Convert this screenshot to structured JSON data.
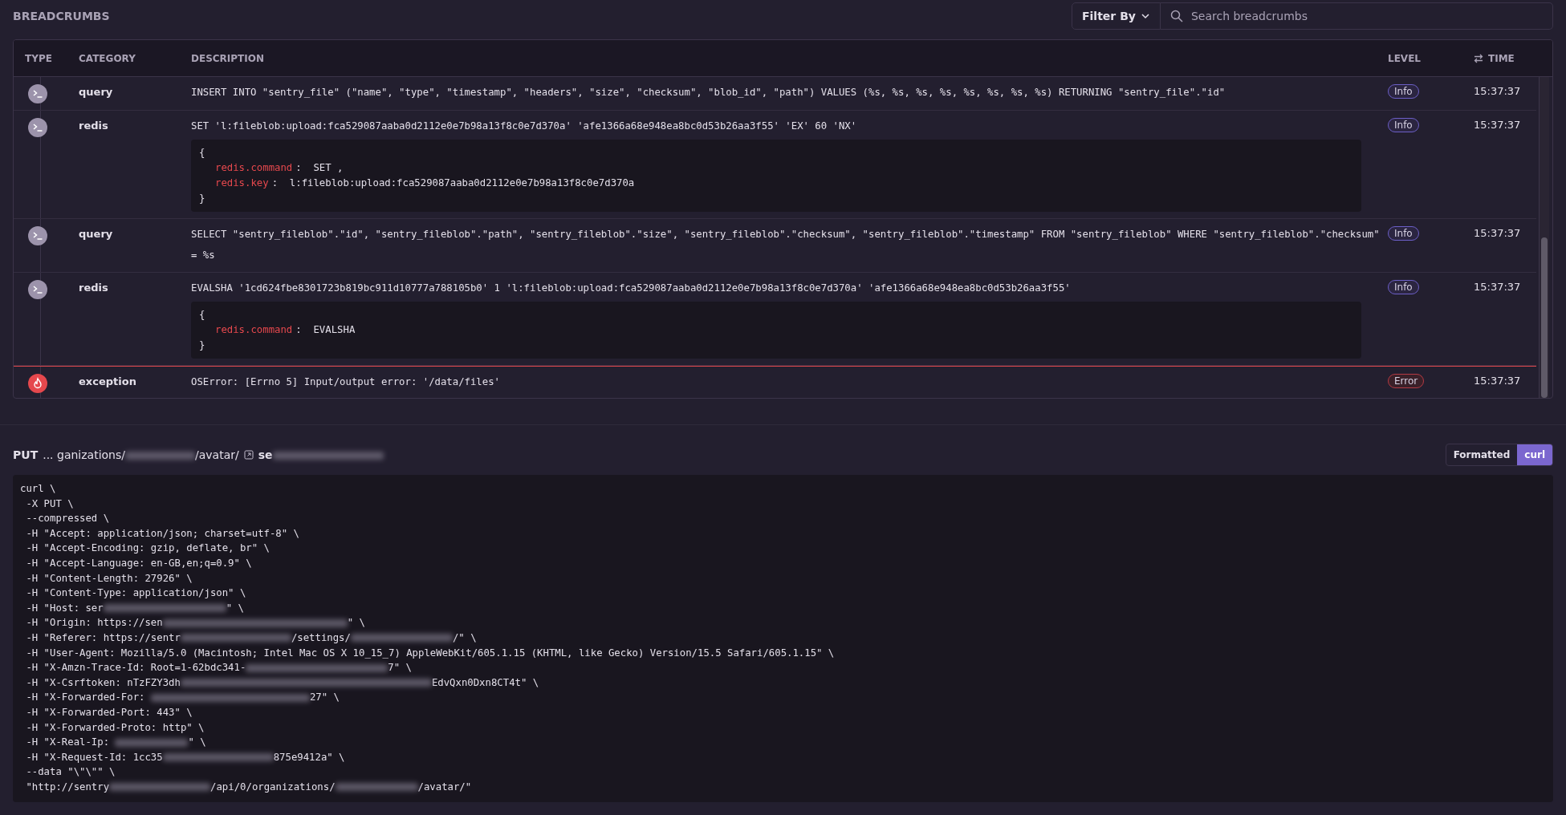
{
  "breadcrumbs": {
    "title": "BREADCRUMBS",
    "filter": {
      "label": "Filter By"
    },
    "search": {
      "placeholder": "Search breadcrumbs"
    },
    "columns": [
      "TYPE",
      "CATEGORY",
      "DESCRIPTION",
      "LEVEL",
      "TIME"
    ],
    "rows": [
      {
        "kind": "default",
        "category": "query",
        "description": "INSERT INTO \"sentry_file\" (\"name\", \"type\", \"timestamp\", \"headers\", \"size\", \"checksum\", \"blob_id\", \"path\") VALUES (%s, %s, %s, %s, %s, %s, %s, %s) RETURNING \"sentry_file\".\"id\"",
        "level": "Info",
        "time": "15:37:37"
      },
      {
        "kind": "default",
        "category": "redis",
        "description": "SET 'l:fileblob:upload:fca529087aaba0d2112e0e7b98a13f8c0e7d370a' 'afe1366a68e948ea8bc0d53b26aa3f55' 'EX' 60 'NX'",
        "data": {
          "open": "{",
          "entries": [
            {
              "key": "redis.command",
              "value": ":  SET ,"
            },
            {
              "key": "redis.key",
              "value": ":  l:fileblob:upload:fca529087aaba0d2112e0e7b98a13f8c0e7d370a"
            }
          ],
          "close": "}"
        },
        "level": "Info",
        "time": "15:37:37"
      },
      {
        "kind": "default",
        "category": "query",
        "description": "SELECT \"sentry_fileblob\".\"id\", \"sentry_fileblob\".\"path\", \"sentry_fileblob\".\"size\", \"sentry_fileblob\".\"checksum\", \"sentry_fileblob\".\"timestamp\" FROM \"sentry_fileblob\" WHERE \"sentry_fileblob\".\"checksum\" = %s",
        "level": "Info",
        "time": "15:37:37"
      },
      {
        "kind": "default",
        "category": "redis",
        "description": "EVALSHA '1cd624fbe8301723b819bc911d10777a788105b0' 1 'l:fileblob:upload:fca529087aaba0d2112e0e7b98a13f8c0e7d370a' 'afe1366a68e948ea8bc0d53b26aa3f55'",
        "data": {
          "open": "{",
          "entries": [
            {
              "key": "redis.command",
              "value": ":  EVALSHA"
            }
          ],
          "close": "}"
        },
        "level": "Info",
        "time": "15:37:37"
      },
      {
        "kind": "error",
        "category": "exception",
        "description": "OSError: [Errno 5] Input/output error: '/data/files'",
        "level": "Error",
        "time": "15:37:37"
      }
    ]
  },
  "request": {
    "method": "PUT",
    "url": [
      "... ganizations/",
      {
        "kind": "redacted"
      },
      "/avatar/"
    ],
    "host": [
      "se",
      {
        "kind": "redacted"
      }
    ],
    "formats": [
      {
        "label": "Formatted",
        "selected": false
      },
      {
        "label": "curl",
        "selected": true
      }
    ],
    "lines": [
      [
        "curl \\"
      ],
      [
        " -X PUT \\"
      ],
      [
        " --compressed \\"
      ],
      [
        " -H \"Accept: application/json; charset=utf-8\" \\"
      ],
      [
        " -H \"Accept-Encoding: gzip, deflate, br\" \\"
      ],
      [
        " -H \"Accept-Language: en-GB,en;q=0.9\" \\"
      ],
      [
        " -H \"Content-Length: 27926\" \\"
      ],
      [
        " -H \"Content-Type: application/json\" \\"
      ],
      [
        " -H \"Host: ser",
        {
          "kind": "redacted"
        },
        "\" \\"
      ],
      [
        " -H \"Origin: https://sen",
        {
          "kind": "redacted"
        },
        "\" \\"
      ],
      [
        " -H \"Referer: https://sentr",
        {
          "kind": "redacted"
        },
        "/settings/",
        {
          "kind": "redacted"
        },
        "/\" \\"
      ],
      [
        " -H \"User-Agent: Mozilla/5.0 (Macintosh; Intel Mac OS X 10_15_7) AppleWebKit/605.1.15 (KHTML, like Gecko) Version/15.5 Safari/605.1.15\" \\"
      ],
      [
        " -H \"X-Amzn-Trace-Id: Root=1-62bdc341-",
        {
          "kind": "redacted"
        },
        "7\" \\"
      ],
      [
        " -H \"X-Csrftoken: nTzFZY3dh",
        {
          "kind": "redacted"
        },
        "EdvQxn0Dxn8CT4t\" \\"
      ],
      [
        " -H \"X-Forwarded-For: ",
        {
          "kind": "redacted"
        },
        "27\" \\"
      ],
      [
        " -H \"X-Forwarded-Port: 443\" \\"
      ],
      [
        " -H \"X-Forwarded-Proto: http\" \\"
      ],
      [
        " -H \"X-Real-Ip: ",
        {
          "kind": "redacted"
        },
        "\" \\"
      ],
      [
        " -H \"X-Request-Id: 1cc35",
        {
          "kind": "redacted"
        },
        "875e9412a\" \\"
      ],
      [
        " --data \"\\\"\\\"\" \\"
      ],
      [
        " \"http://sentry",
        {
          "kind": "redacted"
        },
        "/api/0/organizations/",
        {
          "kind": "redacted"
        },
        "/avatar/\""
      ]
    ]
  }
}
